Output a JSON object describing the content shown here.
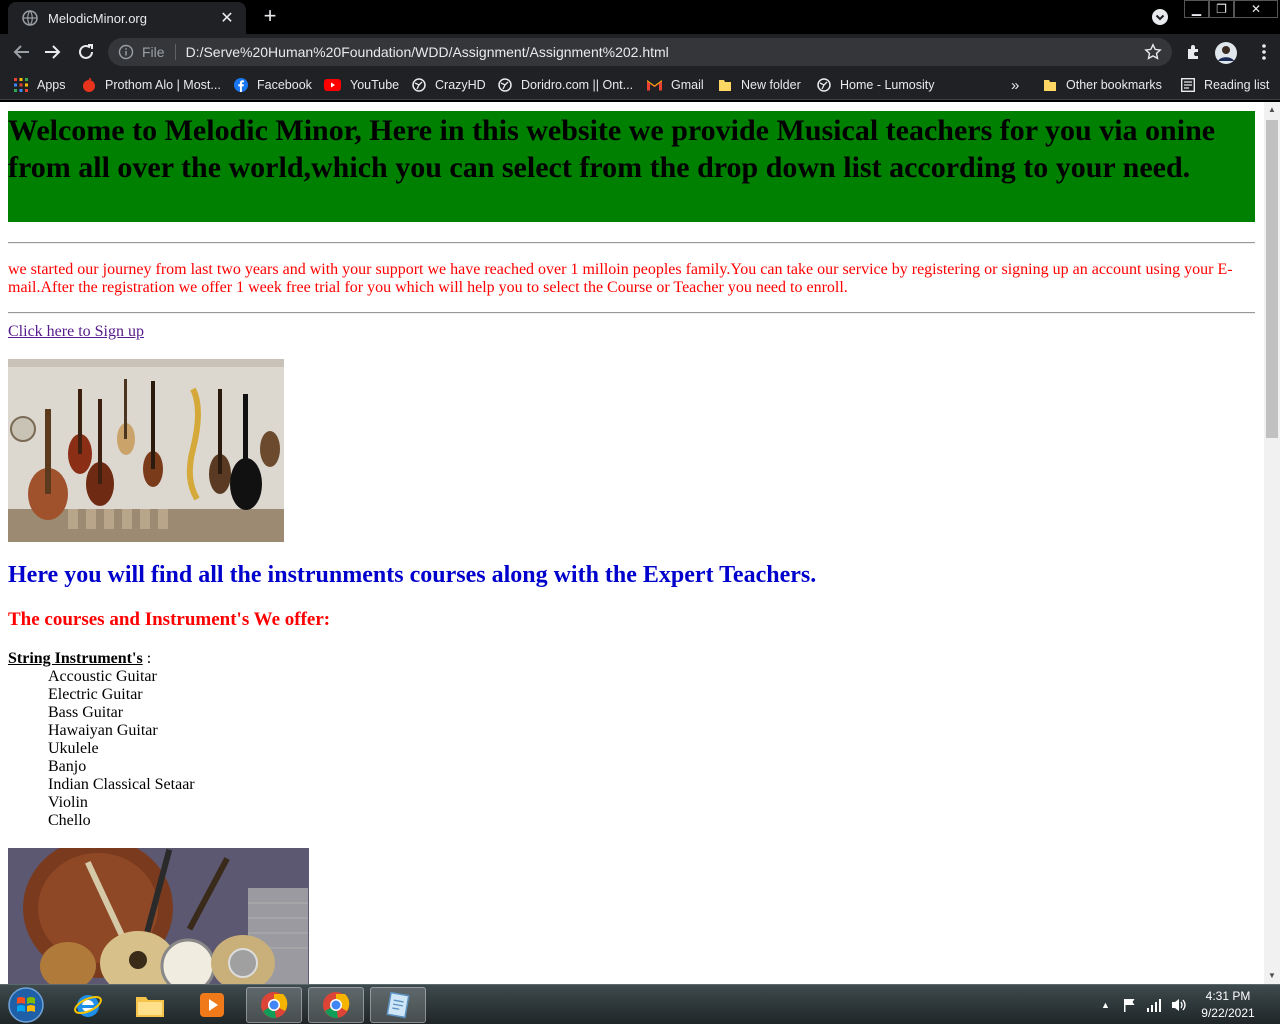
{
  "browser": {
    "tab_title": "MelodicMinor.org",
    "tab_close": "✕",
    "new_tab": "+",
    "url_scheme": "File",
    "url": "D:/Serve%20Human%20Foundation/WDD/Assignment/Assignment%202.html",
    "bookmarks": [
      {
        "label": "Apps",
        "icon": "apps-grid-icon"
      },
      {
        "label": "Prothom Alo | Most...",
        "icon": "prothom-alo-icon"
      },
      {
        "label": "Facebook",
        "icon": "facebook-icon"
      },
      {
        "label": "YouTube",
        "icon": "youtube-icon"
      },
      {
        "label": "CrazyHD",
        "icon": "globe-icon"
      },
      {
        "label": "Doridro.com || Ont...",
        "icon": "globe-icon"
      },
      {
        "label": "Gmail",
        "icon": "gmail-icon"
      },
      {
        "label": "New folder",
        "icon": "folder-icon"
      },
      {
        "label": "Home - Lumosity",
        "icon": "globe-icon"
      }
    ],
    "bookmarks_overflow": "»",
    "other_bookmarks": "Other bookmarks",
    "reading_list": "Reading list"
  },
  "page": {
    "welcome": "Welcome to Melodic Minor, Here in this website we provide Musical teachers for you via onine from all over the world,which you can select from the drop down list according to your need.",
    "intro": "we started our journey from last two years and with your support we have reached over 1 milloin peoples family.You can take our service by registering or signing up an account using your E-mail.After the registration we offer 1 week free trial for you which will help you to select the Course or Teacher you need to enroll.",
    "signup_link": "Click here to Sign up",
    "heading_courses": "Here you will find all the instrunments courses along with the Expert Teachers.",
    "heading_offer": "The courses and Instrument's We offer:",
    "string_title": "String Instrument's",
    "string_colon": " :",
    "string_instruments": [
      "Accoustic Guitar",
      "Electric Guitar",
      "Bass Guitar",
      "Hawaiyan Guitar",
      "Ukulele",
      "Banjo",
      "Indian Classical Setaar",
      "Violin",
      "Chello"
    ]
  },
  "taskbar": {
    "time": "4:31 PM",
    "date": "9/22/2021"
  },
  "colors": {
    "welcome_bg": "#008000",
    "intro_text": "#ff0000",
    "heading_blue": "#0000cd",
    "heading_red": "#ff0000",
    "link": "#551a8b"
  }
}
